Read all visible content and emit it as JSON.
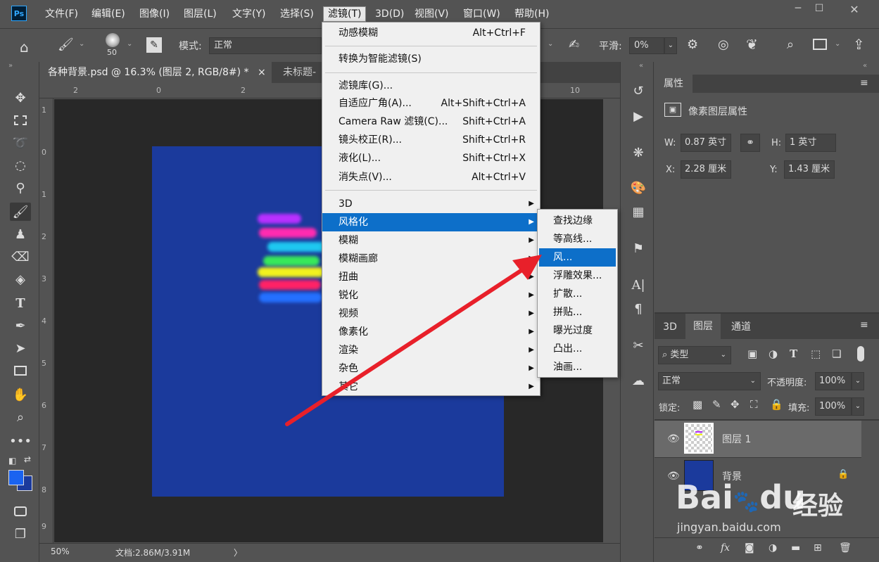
{
  "app": {
    "logo": "Ps",
    "window_controls": [
      "─",
      "☐",
      "✕"
    ]
  },
  "menubar": {
    "items": [
      "文件(F)",
      "编辑(E)",
      "图像(I)",
      "图层(L)",
      "文字(Y)",
      "选择(S)",
      "滤镜(T)",
      "3D(D)",
      "视图(V)",
      "窗口(W)",
      "帮助(H)"
    ],
    "active": "滤镜(T)"
  },
  "options": {
    "brush_size": "50",
    "mode_label": "模式:",
    "mode_value": "正常",
    "smooth_label": "平滑:",
    "smooth_value": "0%"
  },
  "doc_tabs": [
    {
      "label": "各种背景.psd @ 16.3% (图层 2, RGB/8#) *",
      "close": "×"
    },
    {
      "label": "未标题-"
    }
  ],
  "ruler": {
    "h": [
      "2",
      "0",
      "2",
      "10"
    ],
    "v": [
      "1",
      "0",
      "1",
      "2",
      "3",
      "4",
      "5",
      "6",
      "7",
      "8",
      "9"
    ]
  },
  "status": {
    "zoom": "50%",
    "doc": "文档:2.86M/3.91M",
    "arrow": "〉"
  },
  "filter_menu": {
    "items": [
      {
        "label": "动感模糊",
        "shortcut": "Alt+Ctrl+F"
      },
      {
        "label": "转换为智能滤镜(S)"
      },
      {
        "label": "滤镜库(G)..."
      },
      {
        "label": "自适应广角(A)...",
        "shortcut": "Alt+Shift+Ctrl+A"
      },
      {
        "label": "Camera Raw 滤镜(C)...",
        "shortcut": "Shift+Ctrl+A"
      },
      {
        "label": "镜头校正(R)...",
        "shortcut": "Shift+Ctrl+R"
      },
      {
        "label": "液化(L)...",
        "shortcut": "Shift+Ctrl+X"
      },
      {
        "label": "消失点(V)...",
        "shortcut": "Alt+Ctrl+V"
      },
      {
        "label": "3D"
      },
      {
        "label": "风格化"
      },
      {
        "label": "模糊"
      },
      {
        "label": "模糊画廊"
      },
      {
        "label": "扭曲"
      },
      {
        "label": "锐化"
      },
      {
        "label": "视频"
      },
      {
        "label": "像素化"
      },
      {
        "label": "渲染"
      },
      {
        "label": "杂色"
      },
      {
        "label": "其它"
      }
    ],
    "submenu_arrow": "▶"
  },
  "stylize_submenu": {
    "items": [
      "查找边缘",
      "等高线...",
      "风...",
      "浮雕效果...",
      "扩散...",
      "拼贴...",
      "曝光过度",
      "凸出...",
      "油画..."
    ],
    "highlighted": "风..."
  },
  "properties": {
    "tab": "属性",
    "title": "像素图层属性",
    "w_label": "W:",
    "w_value": "0.87 英寸",
    "h_label": "H:",
    "h_value": "1 英寸",
    "x_label": "X:",
    "x_value": "2.28 厘米",
    "y_label": "Y:",
    "y_value": "1.43 厘米"
  },
  "layers": {
    "tabs": [
      "3D",
      "图层",
      "通道"
    ],
    "filter_label": "类型",
    "blend": "正常",
    "opacity_label": "不透明度:",
    "opacity": "100%",
    "lock_label": "锁定:",
    "fill_label": "填充:",
    "fill": "100%",
    "rows": [
      {
        "name": "图层 1"
      },
      {
        "name": "背景"
      }
    ],
    "footer_fx": "fx"
  },
  "watermark": {
    "brand": "Bai",
    "brand2": "du",
    "cn": "经验",
    "url": "jingyan.baidu.com"
  }
}
